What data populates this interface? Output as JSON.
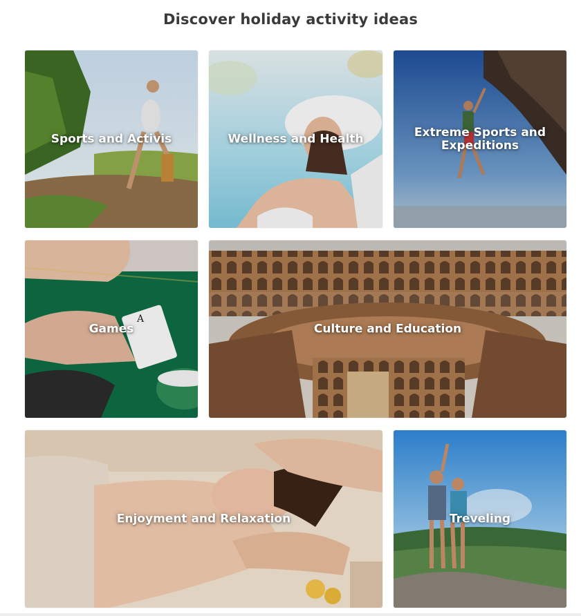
{
  "section": {
    "title": "Discover holiday activity ideas"
  },
  "tiles": [
    {
      "label": "Sports and Activis",
      "icon": "runner-photo",
      "colors": [
        "#a9c9e6",
        "#7a9a3c",
        "#8a6a48"
      ]
    },
    {
      "label": "Wellness and Health",
      "icon": "sunbathing-woman-photo",
      "colors": [
        "#9fd3e6",
        "#e9d9cc",
        "#f5f5f5"
      ]
    },
    {
      "label": "Extreme Sports and Expeditions",
      "icon": "rock-climber-photo",
      "colors": [
        "#2a5fa8",
        "#5c4a3a",
        "#9fb7cc"
      ]
    },
    {
      "label": "Games",
      "icon": "poker-table-photo",
      "colors": [
        "#0f7a4a",
        "#e3b89c",
        "#2d2d2d"
      ]
    },
    {
      "label": "Culture and Education",
      "icon": "colosseum-photo",
      "colors": [
        "#c9c3bb",
        "#a8744a",
        "#6b4a32"
      ]
    },
    {
      "label": "Enjoyment and Relaxation",
      "icon": "massage-photo",
      "colors": [
        "#e8c6a8",
        "#c07a50",
        "#f2e6d8"
      ]
    },
    {
      "label": "Treveling",
      "icon": "hikers-selfie-photo",
      "colors": [
        "#4ea3e6",
        "#3a6b3a",
        "#c9d6de"
      ]
    }
  ]
}
